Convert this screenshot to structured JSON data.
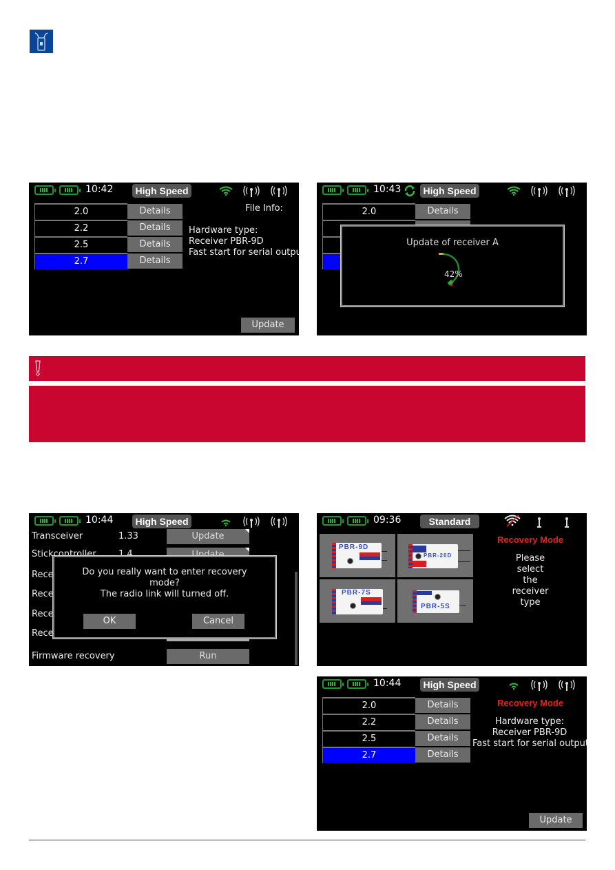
{
  "logo": {
    "icon": "receiver-antenna-icon"
  },
  "screens": {
    "file_select": {
      "status": {
        "time": "10:42",
        "mode": "High Speed",
        "icons": [
          "battery-icon",
          "battery-icon",
          "wifi-icon",
          "antenna-icon",
          "antenna-icon"
        ]
      },
      "versions": [
        {
          "version": "2.0",
          "button": "Details",
          "selected": false
        },
        {
          "version": "2.2",
          "button": "Details",
          "selected": false
        },
        {
          "version": "2.5",
          "button": "Details",
          "selected": false
        },
        {
          "version": "2.7",
          "button": "Details",
          "selected": true
        }
      ],
      "file_info": {
        "title": "File Info:",
        "lines": [
          "Hardware type:",
          "Receiver PBR-9D",
          "Fast start for serial output"
        ]
      },
      "update_button": "Update"
    },
    "updating": {
      "status": {
        "time": "10:43",
        "mode": "High Speed",
        "icons": [
          "battery-icon",
          "battery-icon",
          "sync-icon",
          "wifi-icon",
          "antenna-icon",
          "antenna-icon"
        ]
      },
      "background_row": {
        "version": "2.0",
        "button": "Details"
      },
      "dialog": {
        "title": "Update of receiver  A",
        "progress_percent": 42,
        "progress_label": "42%"
      }
    },
    "recovery_confirm": {
      "status": {
        "time": "10:44",
        "mode": "High Speed"
      },
      "rows": [
        {
          "label": "Transceiver",
          "value": "1.33",
          "button": "Update"
        },
        {
          "label": "Stickcontroller",
          "value": "1.4",
          "button": "Update"
        },
        {
          "label": "Rece",
          "value": "",
          "button": ""
        },
        {
          "label": "Rece",
          "value": "",
          "button": ""
        },
        {
          "label": "Rece",
          "value": "",
          "button": ""
        },
        {
          "label": "Rece",
          "value": "",
          "button": ""
        },
        {
          "label": "Firmware recovery",
          "value": "",
          "button": "Run"
        }
      ],
      "dialog": {
        "line1": "Do you really want to enter recovery",
        "line2": "mode?",
        "line3": "The radio link will turned off.",
        "ok": "OK",
        "cancel": "Cancel"
      }
    },
    "recovery_select": {
      "status": {
        "time": "09:36",
        "mode": "Standard",
        "icons": [
          "battery-icon",
          "battery-icon",
          "wifi-off-icon",
          "antenna-icon",
          "antenna-icon"
        ]
      },
      "receivers": [
        {
          "name": "PBR-9D"
        },
        {
          "name": "PBR-26D"
        },
        {
          "name": "PBR-7S"
        },
        {
          "name": "PBR-5S"
        }
      ],
      "title": "Recovery Mode",
      "prompt": [
        "Please",
        "select",
        "the",
        "receiver",
        "type"
      ]
    },
    "recovery_file": {
      "status": {
        "time": "10:44",
        "mode": "High Speed"
      },
      "versions": [
        {
          "version": "2.0",
          "button": "Details",
          "selected": false
        },
        {
          "version": "2.2",
          "button": "Details",
          "selected": false
        },
        {
          "version": "2.5",
          "button": "Details",
          "selected": false
        },
        {
          "version": "2.7",
          "button": "Details",
          "selected": true
        }
      ],
      "title": "Recovery Mode",
      "lines": [
        "Hardware type:",
        "Receiver PBR-9D",
        "Fast start for serial outputs"
      ],
      "update_button": "Update"
    }
  },
  "warning": {
    "icon": "exclamation-icon",
    "color": "#c8062f"
  },
  "colors": {
    "selected_row": "#0000ff",
    "recovery_title": "#e8241a",
    "battery": "#21b331"
  }
}
